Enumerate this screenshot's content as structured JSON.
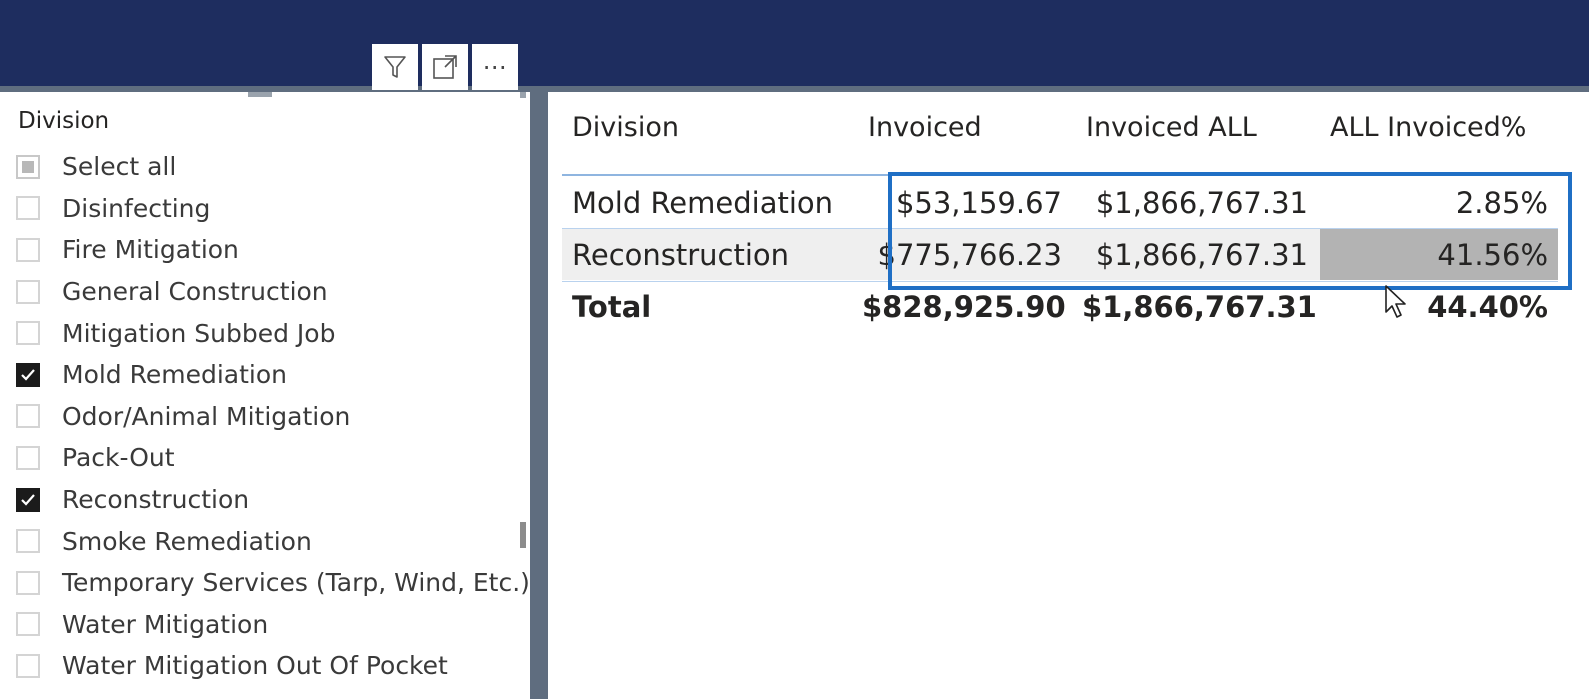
{
  "toolbar": {
    "filter_icon": "filter-icon",
    "focus_icon": "focus-mode-icon",
    "more_icon": "more-options-icon",
    "more_label": "⋯"
  },
  "slicer": {
    "title": "Division",
    "items": [
      {
        "label": "Select all",
        "state": "partial"
      },
      {
        "label": "Disinfecting",
        "state": "unchecked"
      },
      {
        "label": "Fire Mitigation",
        "state": "unchecked"
      },
      {
        "label": "General Construction",
        "state": "unchecked"
      },
      {
        "label": "Mitigation Subbed Job",
        "state": "unchecked"
      },
      {
        "label": "Mold Remediation",
        "state": "checked"
      },
      {
        "label": "Odor/Animal Mitigation",
        "state": "unchecked"
      },
      {
        "label": "Pack-Out",
        "state": "unchecked"
      },
      {
        "label": "Reconstruction",
        "state": "checked"
      },
      {
        "label": "Smoke Remediation",
        "state": "unchecked"
      },
      {
        "label": "Temporary Services (Tarp, Wind, Etc.)",
        "state": "unchecked"
      },
      {
        "label": "Water Mitigation",
        "state": "unchecked"
      },
      {
        "label": "Water Mitigation Out Of Pocket",
        "state": "unchecked"
      }
    ]
  },
  "table": {
    "headers": [
      "Division",
      "Invoiced",
      "Invoiced ALL",
      "ALL Invoiced%"
    ],
    "rows": [
      {
        "division": "Mold Remediation",
        "invoiced": "$53,159.67",
        "invoiced_all": "$1,866,767.31",
        "pct": "2.85%"
      },
      {
        "division": "Reconstruction",
        "invoiced": "$775,766.23",
        "invoiced_all": "$1,866,767.31",
        "pct": "41.56%"
      }
    ],
    "total": {
      "division": "Total",
      "invoiced": "$828,925.90",
      "invoiced_all": "$1,866,767.31",
      "pct": "44.40%"
    }
  },
  "colors": {
    "topbar": "#1e2d5f",
    "highlight_box": "#1f6fc5",
    "pct_bar": "#b3b3b3"
  }
}
